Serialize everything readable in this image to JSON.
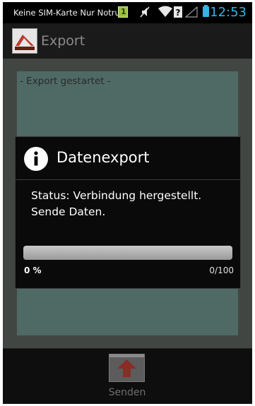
{
  "status_bar": {
    "carrier": "Keine SIM-Karte Nur Notrufe",
    "sim_badge": "1",
    "time": "12:53",
    "icons": [
      "sim-notification-icon",
      "muted-icon",
      "wifi-icon",
      "data-unknown-icon",
      "no-signal-icon",
      "battery-icon"
    ],
    "clock_color": "#33b5e5"
  },
  "action_bar": {
    "title": "Export",
    "logo_icon": "app-logo-icon"
  },
  "content": {
    "log_text": "- Export gestartet -"
  },
  "bottom_bar": {
    "send_label": "Senden",
    "send_icon": "upload-arrow-icon"
  },
  "dialog": {
    "icon": "info-icon",
    "title": "Datenexport",
    "message_line1": "Status: Verbindung hergestellt.",
    "message_line2": "Sende Daten.",
    "progress_percent": "0 %",
    "progress_count": "0/100",
    "progress_value": 0,
    "progress_max": 100
  }
}
